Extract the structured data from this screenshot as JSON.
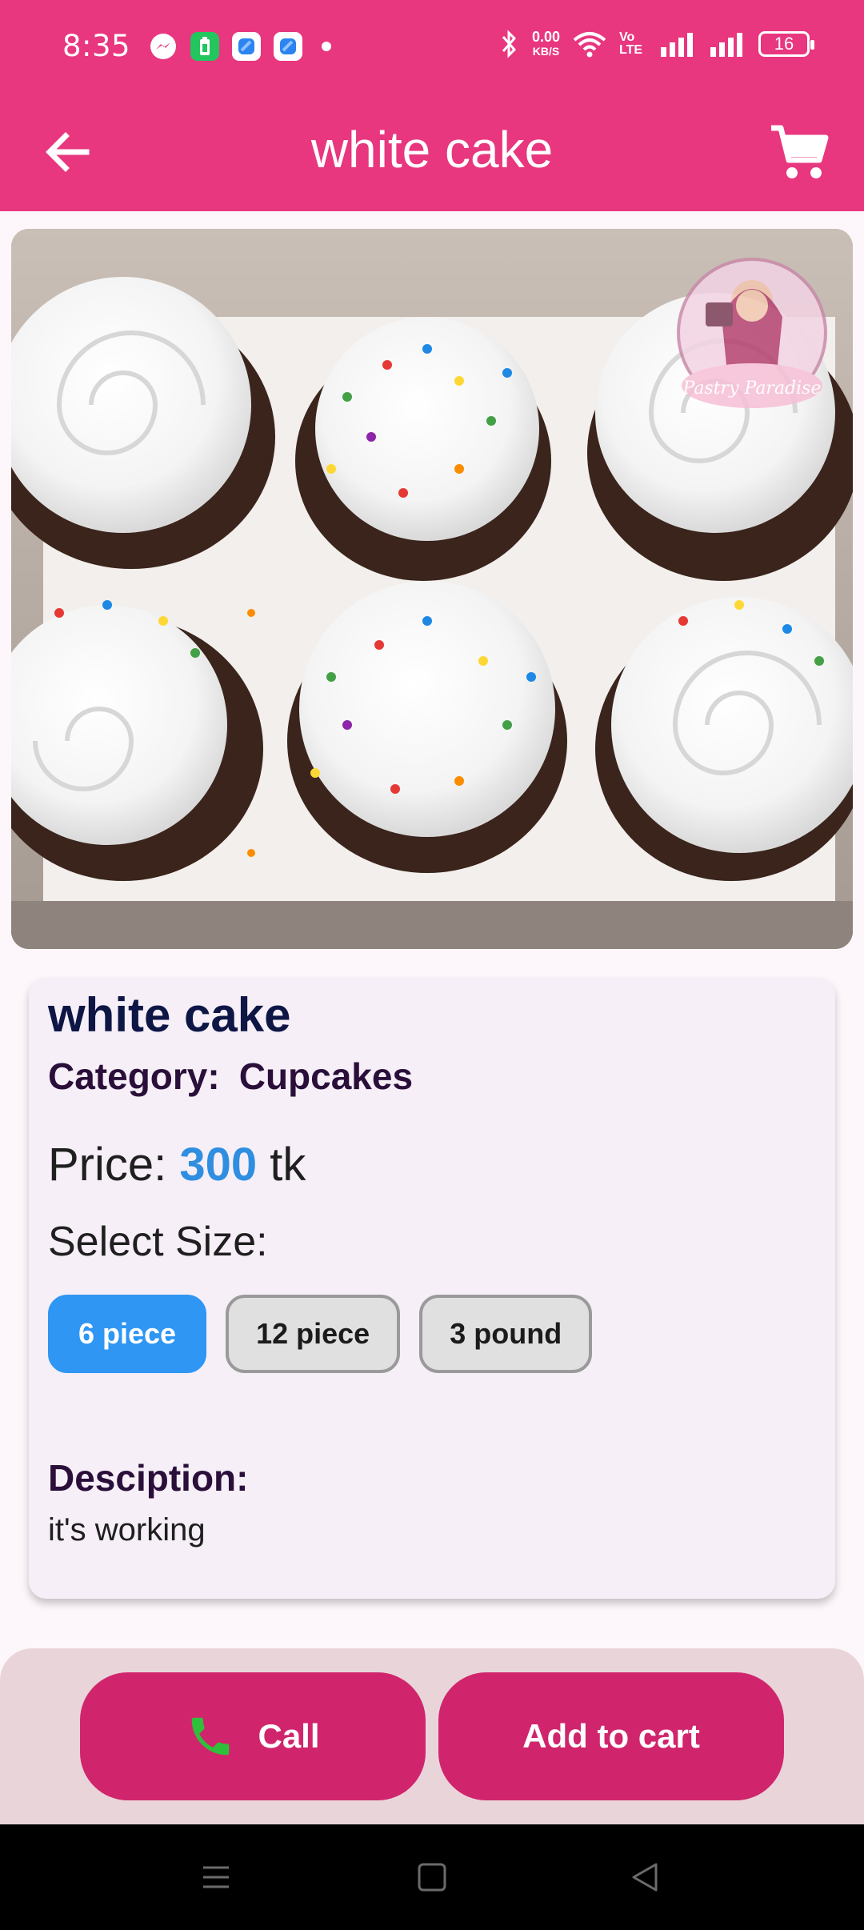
{
  "status_bar": {
    "time": "8:35",
    "net_speed_value": "0.00",
    "net_speed_unit": "KB/S",
    "volte_label": "Vo LTE",
    "battery_level": "16",
    "notification_icons": [
      "messenger-icon",
      "battery-saver-icon",
      "app-icon",
      "app-icon"
    ],
    "system_icons": [
      "bluetooth-icon",
      "wifi-icon",
      "signal-icon",
      "signal-icon",
      "battery-icon"
    ]
  },
  "app_bar": {
    "title": "white cake",
    "back_icon": "arrow-left-icon",
    "cart_icon": "shopping-cart-icon"
  },
  "product": {
    "image_alt": "cupcakes",
    "watermark_text": "Pastry Paradise",
    "name": "white cake",
    "category_label": "Category:",
    "category_value": "Cupcakes",
    "price_label": "Price:",
    "price_value": "300",
    "price_unit": "tk",
    "select_size_label": "Select Size:",
    "sizes": [
      {
        "label": "6 piece",
        "selected": true
      },
      {
        "label": "12 piece",
        "selected": false
      },
      {
        "label": "3 pound",
        "selected": false
      }
    ],
    "description_label": "Desciption:",
    "description_text": "it's working"
  },
  "actions": {
    "call_label": "Call",
    "add_to_cart_label": "Add to cart"
  },
  "colors": {
    "primary": "#e8367f",
    "button": "#d0256c",
    "selected_chip": "#2f96f3",
    "price": "#2f8ee0",
    "call_icon": "#2fbf3a"
  }
}
